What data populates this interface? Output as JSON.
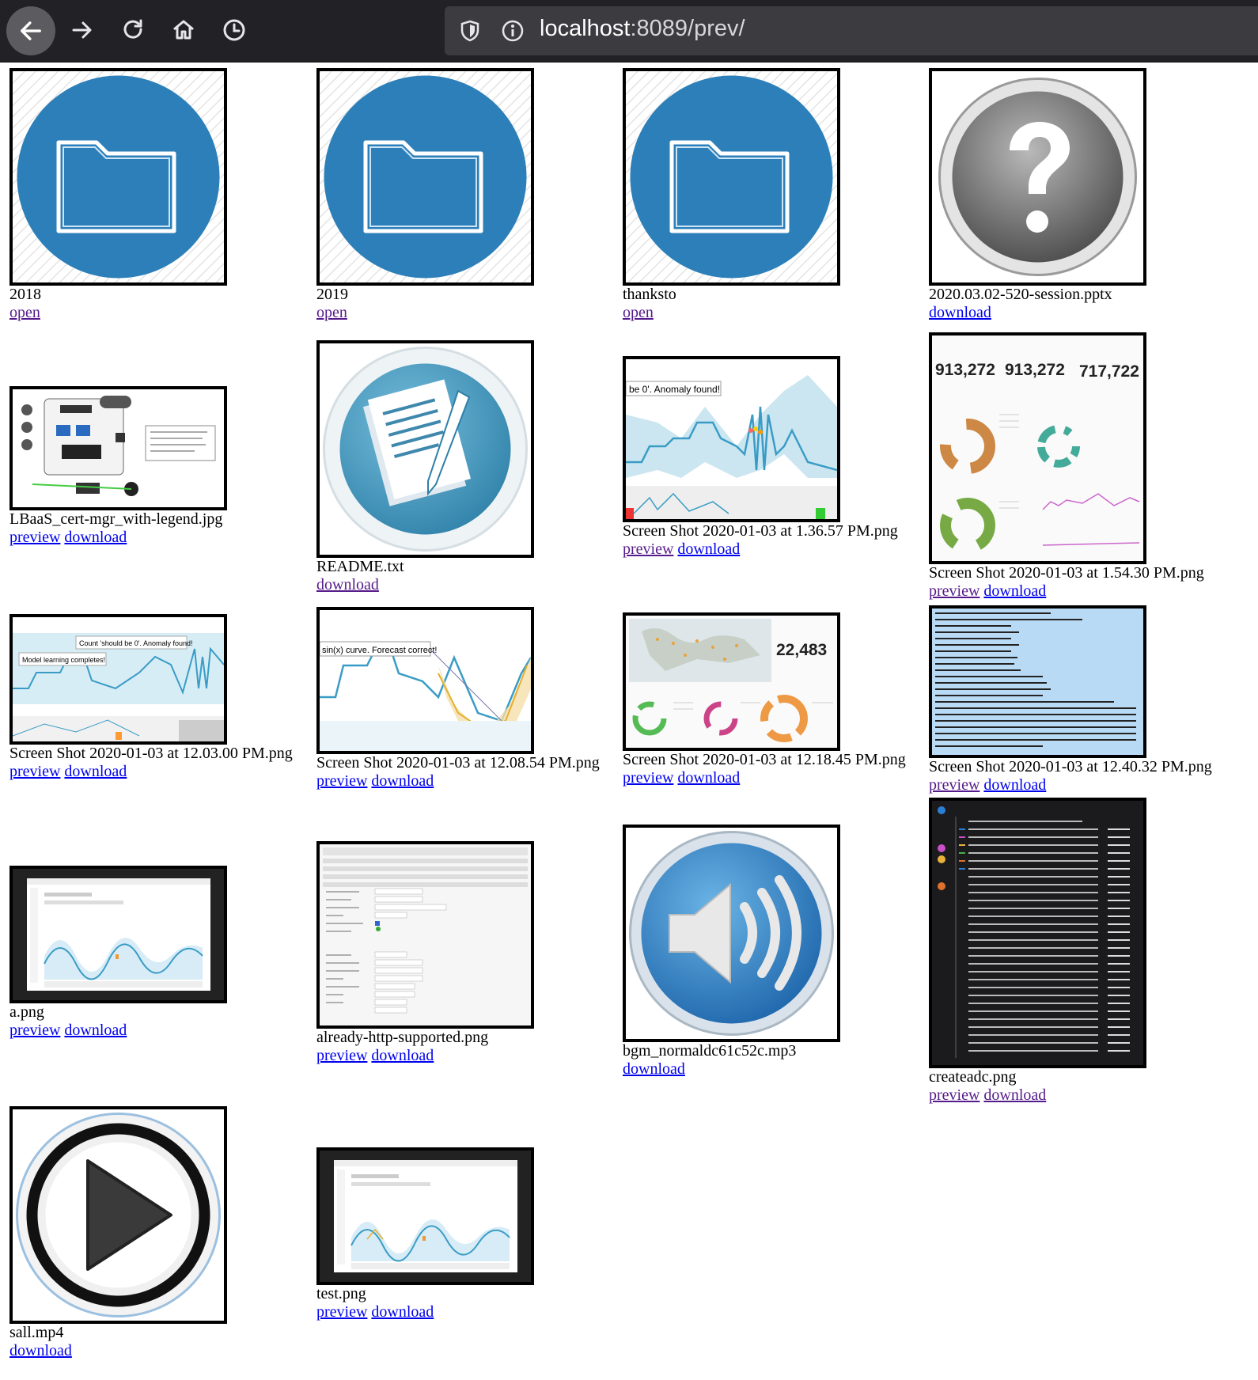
{
  "browser": {
    "url_host": "localhost",
    "url_rest": ":8089/prev/"
  },
  "items": [
    {
      "name": "2018",
      "links": [
        "open"
      ]
    },
    {
      "name": "2019",
      "links": [
        "open"
      ]
    },
    {
      "name": "thanksto",
      "links": [
        "open"
      ]
    },
    {
      "name": "2020.03.02-520-session.pptx",
      "links": [
        "download"
      ]
    },
    {
      "name": "LBaaS_cert-mgr_with-legend.jpg",
      "links": [
        "preview",
        "download"
      ]
    },
    {
      "name": "README.txt",
      "links": [
        "download"
      ]
    },
    {
      "name": "Screen Shot 2020-01-03 at 1.36.57 PM.png",
      "links": [
        "preview",
        "download"
      ]
    },
    {
      "name": "Screen Shot 2020-01-03 at 1.54.30 PM.png",
      "links": [
        "preview",
        "download"
      ]
    },
    {
      "name": "Screen Shot 2020-01-03 at 12.03.00 PM.png",
      "links": [
        "preview",
        "download"
      ]
    },
    {
      "name": "Screen Shot 2020-01-03 at 12.08.54 PM.png",
      "links": [
        "preview",
        "download"
      ]
    },
    {
      "name": "Screen Shot 2020-01-03 at 12.18.45 PM.png",
      "links": [
        "preview",
        "download"
      ]
    },
    {
      "name": "Screen Shot 2020-01-03 at 12.40.32 PM.png",
      "links": [
        "preview",
        "download"
      ]
    },
    {
      "name": "a.png",
      "links": [
        "preview",
        "download"
      ]
    },
    {
      "name": "already-http-supported.png",
      "links": [
        "preview",
        "download"
      ]
    },
    {
      "name": "bgm_normaldc61c52c.mp3",
      "links": [
        "download"
      ]
    },
    {
      "name": "createadc.png",
      "links": [
        "preview",
        "download"
      ]
    },
    {
      "name": "sall.mp4",
      "links": [
        "download"
      ]
    },
    {
      "name": "test.png",
      "links": [
        "preview",
        "download"
      ]
    }
  ],
  "thumb_text": {
    "dash_numbers": [
      "913,272",
      "913,272",
      "717,722"
    ],
    "map_number": "22,483",
    "anomaly_label_1": "be 0'. Anomaly found!",
    "anomaly_label_2": "Count 'should be 0'. Anomaly found!",
    "model_label": "Model learning completes!",
    "forecast_label": "sin(x) curve. Forecast correct!"
  },
  "colors": {
    "folder_blue": "#2c7fb8",
    "link": "#0000ee",
    "link_visited": "#551a8b",
    "terminal_bg": "#b9daf5"
  }
}
